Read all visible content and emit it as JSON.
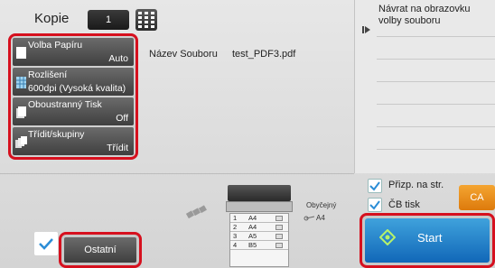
{
  "copies": {
    "label": "Kopie",
    "value": "1"
  },
  "settings": [
    {
      "name": "Volba Papíru",
      "value": "Auto"
    },
    {
      "name": "Rozlišení",
      "value": "600dpi (Vysoká kvalita)"
    },
    {
      "name": "Oboustranný Tisk",
      "value": "Off"
    },
    {
      "name": "Třídit/skupiny",
      "value": "Třídit"
    }
  ],
  "file": {
    "label": "Název Souboru",
    "value": "test_PDF3.pdf"
  },
  "right_panel": {
    "return_label": "Návrat na obrazovku volby souboru"
  },
  "trays": [
    {
      "num": "1",
      "size": "A4"
    },
    {
      "num": "2",
      "size": "A4"
    },
    {
      "num": "3",
      "size": "A5"
    },
    {
      "num": "4",
      "size": "B5"
    }
  ],
  "output_paper": {
    "type": "Obyčejný",
    "size": "A4"
  },
  "options": {
    "fit_page": {
      "label": "Přizp. na str.",
      "checked": true
    },
    "bw_print": {
      "label": "ČB tisk",
      "checked": true
    }
  },
  "buttons": {
    "ca": "CA",
    "start": "Start",
    "other": "Ostatní"
  },
  "colors": {
    "highlight": "#d6101e",
    "start": "#1a7bc8",
    "ca": "#e88a1a"
  }
}
